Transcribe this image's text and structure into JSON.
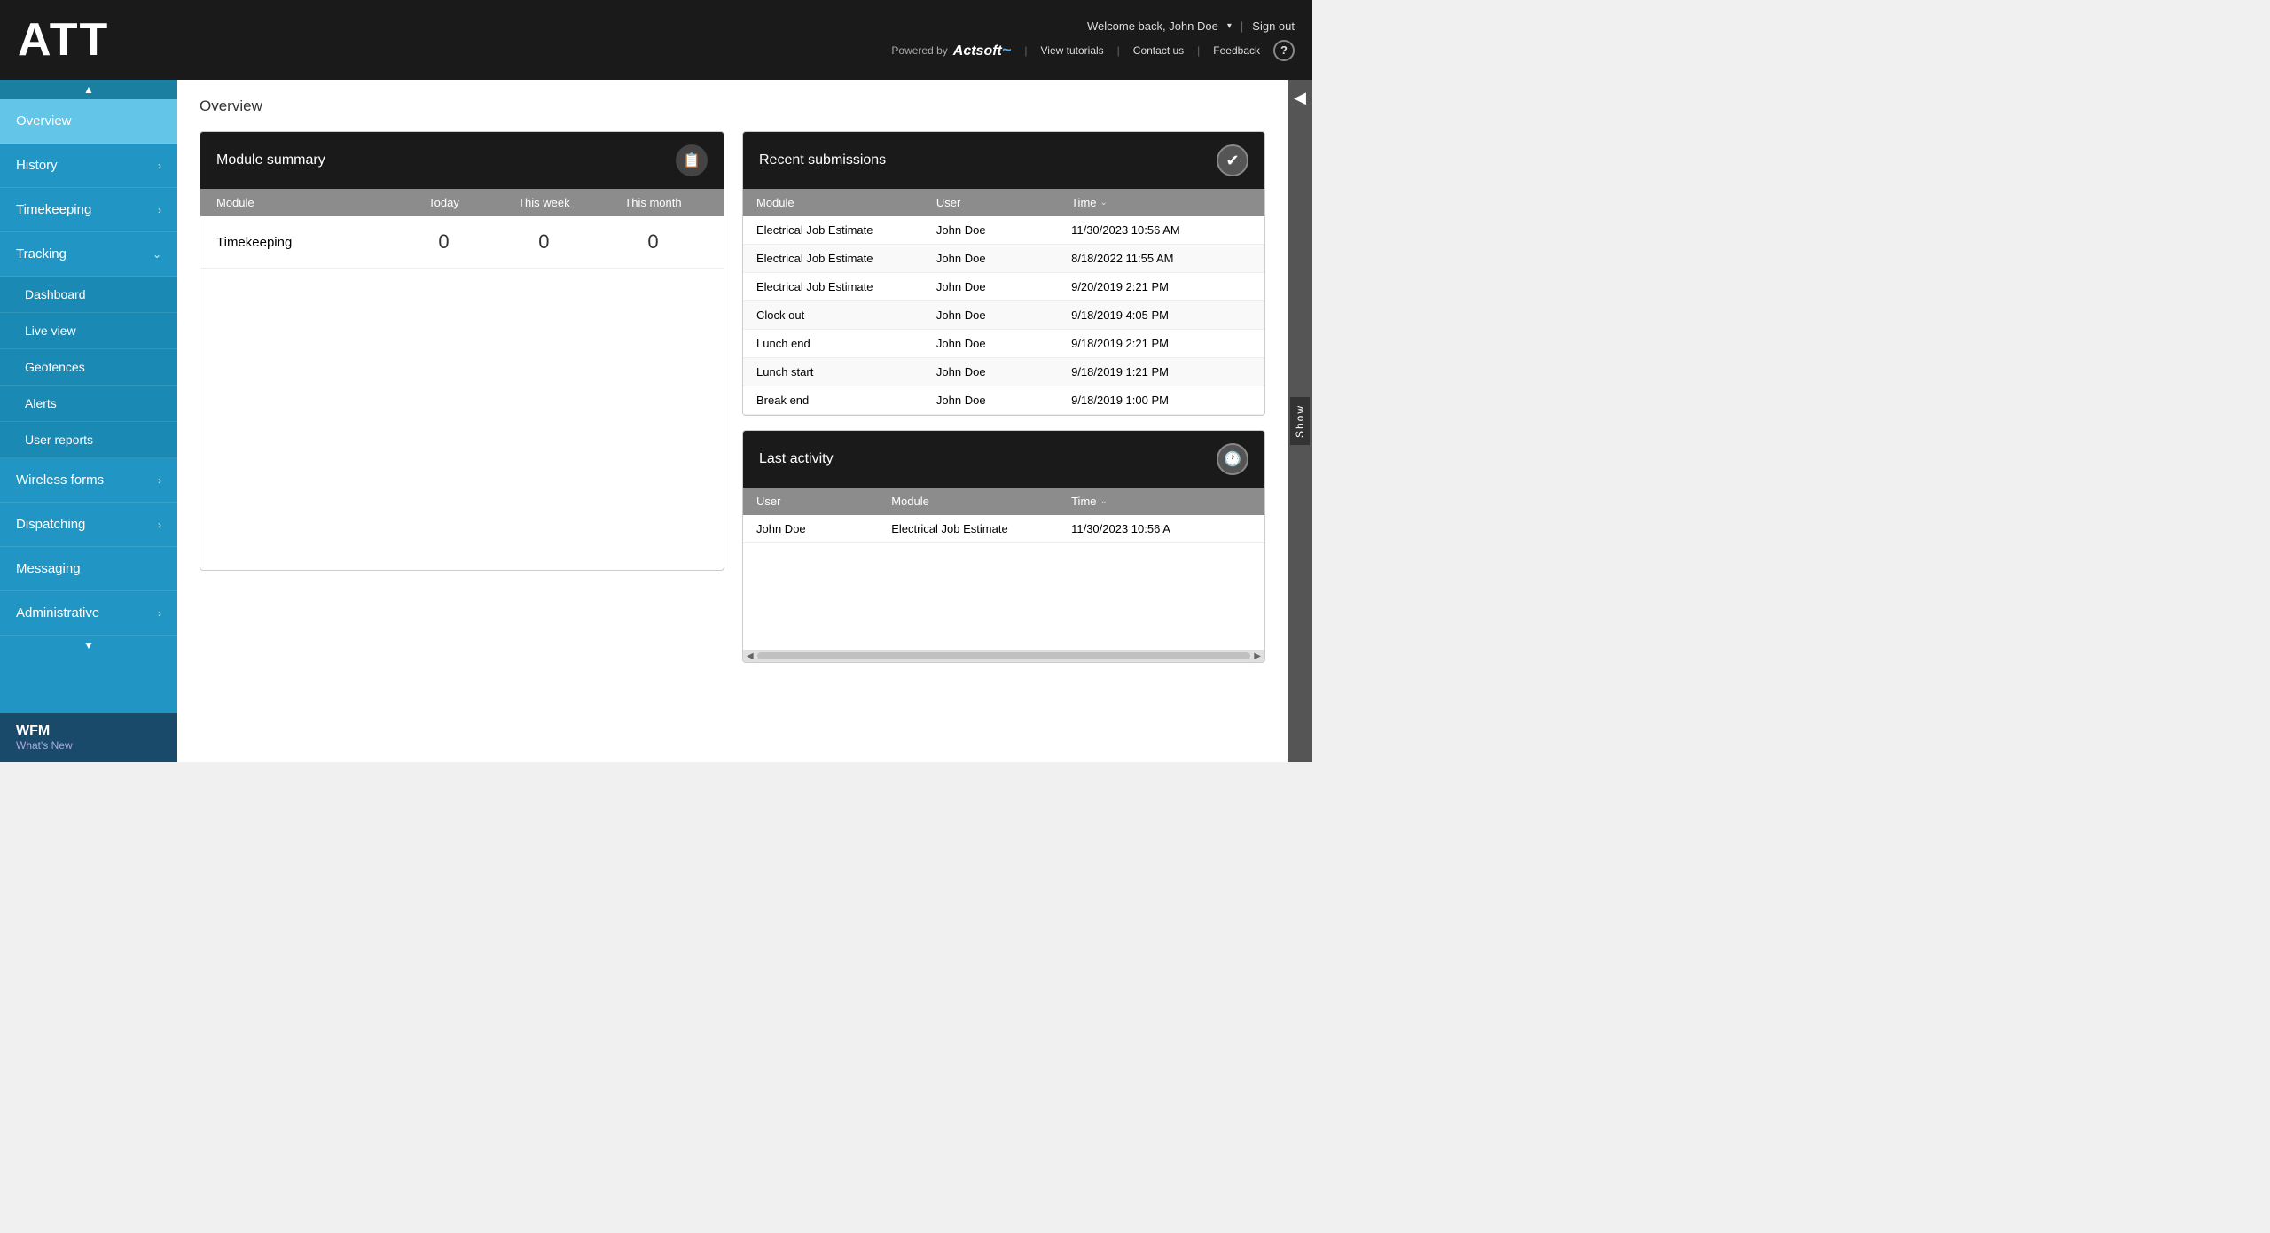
{
  "header": {
    "logo": "ATT",
    "welcome_text": "Welcome back, John Doe",
    "dropdown_symbol": "▾",
    "sign_out": "Sign out",
    "powered_by": "Powered by",
    "actsoft": "Actsoft",
    "view_tutorials": "View tutorials",
    "contact_us": "Contact us",
    "feedback": "Feedback",
    "help": "?"
  },
  "sidebar": {
    "scroll_up": "▲",
    "items": [
      {
        "label": "Overview",
        "active": true,
        "has_arrow": false
      },
      {
        "label": "History",
        "active": false,
        "has_arrow": true
      },
      {
        "label": "Timekeeping",
        "active": false,
        "has_arrow": true
      },
      {
        "label": "Tracking",
        "active": false,
        "has_arrow": true,
        "expanded": true
      },
      {
        "label": "Dashboard",
        "is_sub": true
      },
      {
        "label": "Live view",
        "is_sub": true
      },
      {
        "label": "Geofences",
        "is_sub": true
      },
      {
        "label": "Alerts",
        "is_sub": true
      },
      {
        "label": "User reports",
        "is_sub": true,
        "selected": true
      },
      {
        "label": "Wireless forms",
        "active": false,
        "has_arrow": true
      },
      {
        "label": "Dispatching",
        "active": false,
        "has_arrow": true
      },
      {
        "label": "Messaging",
        "active": false,
        "has_arrow": false
      },
      {
        "label": "Administrative",
        "active": false,
        "has_arrow": true
      }
    ],
    "bottom_title": "WFM",
    "bottom_sub": "What's New"
  },
  "page": {
    "title": "Overview",
    "module_summary": {
      "header": "Module summary",
      "icon": "📋",
      "columns": [
        "Module",
        "Today",
        "This week",
        "This month"
      ],
      "rows": [
        {
          "module": "Timekeeping",
          "today": "0",
          "week": "0",
          "month": "0"
        }
      ]
    },
    "recent_submissions": {
      "header": "Recent submissions",
      "icon": "✔",
      "columns": [
        "Module",
        "User",
        "Time"
      ],
      "rows": [
        {
          "module": "Electrical Job Estimate",
          "user": "John Doe",
          "time": "11/30/2023 10:56 AM"
        },
        {
          "module": "Electrical Job Estimate",
          "user": "John Doe",
          "time": "8/18/2022 11:55 AM"
        },
        {
          "module": "Electrical Job Estimate",
          "user": "John Doe",
          "time": "9/20/2019 2:21 PM"
        },
        {
          "module": "Clock out",
          "user": "John Doe",
          "time": "9/18/2019 4:05 PM"
        },
        {
          "module": "Lunch end",
          "user": "John Doe",
          "time": "9/18/2019 2:21 PM"
        },
        {
          "module": "Lunch start",
          "user": "John Doe",
          "time": "9/18/2019 1:21 PM"
        },
        {
          "module": "Break end",
          "user": "John Doe",
          "time": "9/18/2019 1:00 PM"
        }
      ]
    },
    "last_activity": {
      "header": "Last activity",
      "icon": "🕐",
      "columns": [
        "User",
        "Module",
        "Time"
      ],
      "rows": [
        {
          "user": "John Doe",
          "module": "Electrical Job Estimate",
          "time": "11/30/2023 10:56 A"
        }
      ]
    }
  },
  "right_panel": {
    "back_arrow": "◀",
    "show": "Show"
  }
}
